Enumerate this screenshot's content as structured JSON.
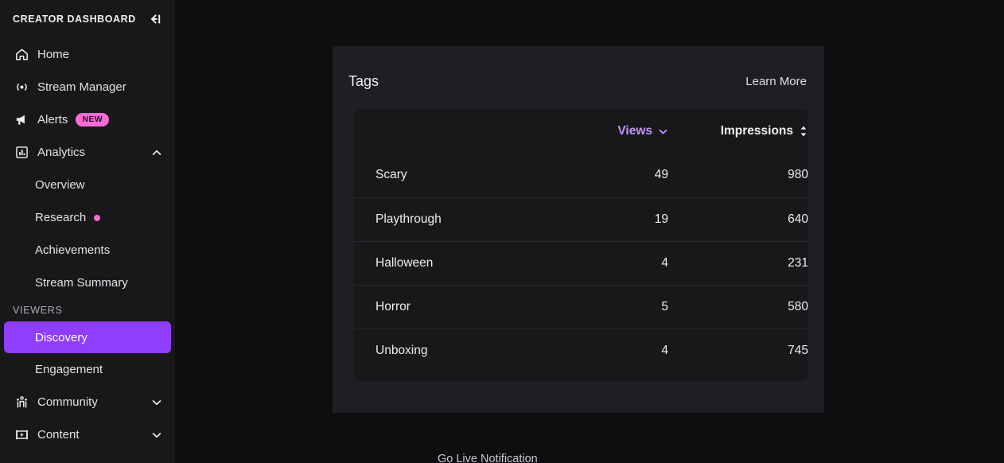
{
  "sidebar": {
    "title": "CREATOR DASHBOARD",
    "collapse_icon": "collapse-left-icon",
    "items": [
      {
        "label": "Home",
        "icon": "home-icon"
      },
      {
        "label": "Stream Manager",
        "icon": "broadcast-icon"
      },
      {
        "label": "Alerts",
        "icon": "megaphone-icon",
        "badge": "NEW"
      },
      {
        "label": "Analytics",
        "icon": "bar-chart-icon",
        "chevron": "chevron-up-icon"
      }
    ],
    "analytics_children": [
      {
        "label": "Overview"
      },
      {
        "label": "Research",
        "dot": true
      },
      {
        "label": "Achievements"
      },
      {
        "label": "Stream Summary"
      }
    ],
    "viewers_section_label": "VIEWERS",
    "viewers_children": [
      {
        "label": "Discovery",
        "active": true
      },
      {
        "label": "Engagement",
        "active": false
      }
    ],
    "bottom_items": [
      {
        "label": "Community",
        "icon": "people-icon",
        "chevron": "chevron-down-icon"
      },
      {
        "label": "Content",
        "icon": "video-frame-icon",
        "chevron": "chevron-down-icon"
      }
    ],
    "colors": {
      "active": "#8f3dff",
      "badge": "#ff6ad5",
      "background": "#18181b"
    }
  },
  "panel": {
    "title": "Tags",
    "learn_more": "Learn More",
    "table": {
      "headers": {
        "tag": "",
        "views": "Views",
        "impressions": "Impressions"
      },
      "views_sort_icon": "chevron-down-icon",
      "impressions_sort_icon": "sort-updown-icon",
      "sorted_by": "Views",
      "rows": [
        {
          "tag": "Scary",
          "views": "49",
          "impressions": "980"
        },
        {
          "tag": "Playthrough",
          "views": "19",
          "impressions": "640"
        },
        {
          "tag": "Halloween",
          "views": "4",
          "impressions": "231"
        },
        {
          "tag": "Horror",
          "views": "5",
          "impressions": "580"
        },
        {
          "tag": "Unboxing",
          "views": "4",
          "impressions": "745"
        }
      ]
    }
  },
  "below": {
    "go_live_notification": "Go Live Notification"
  },
  "theme": {
    "accent_purple": "#8f3dff",
    "link_purple": "#bf94ff",
    "pink": "#ff6ad5",
    "page_bg": "#0e0e10",
    "panel_bg": "#1f1f23",
    "card_bg": "#18181b"
  }
}
